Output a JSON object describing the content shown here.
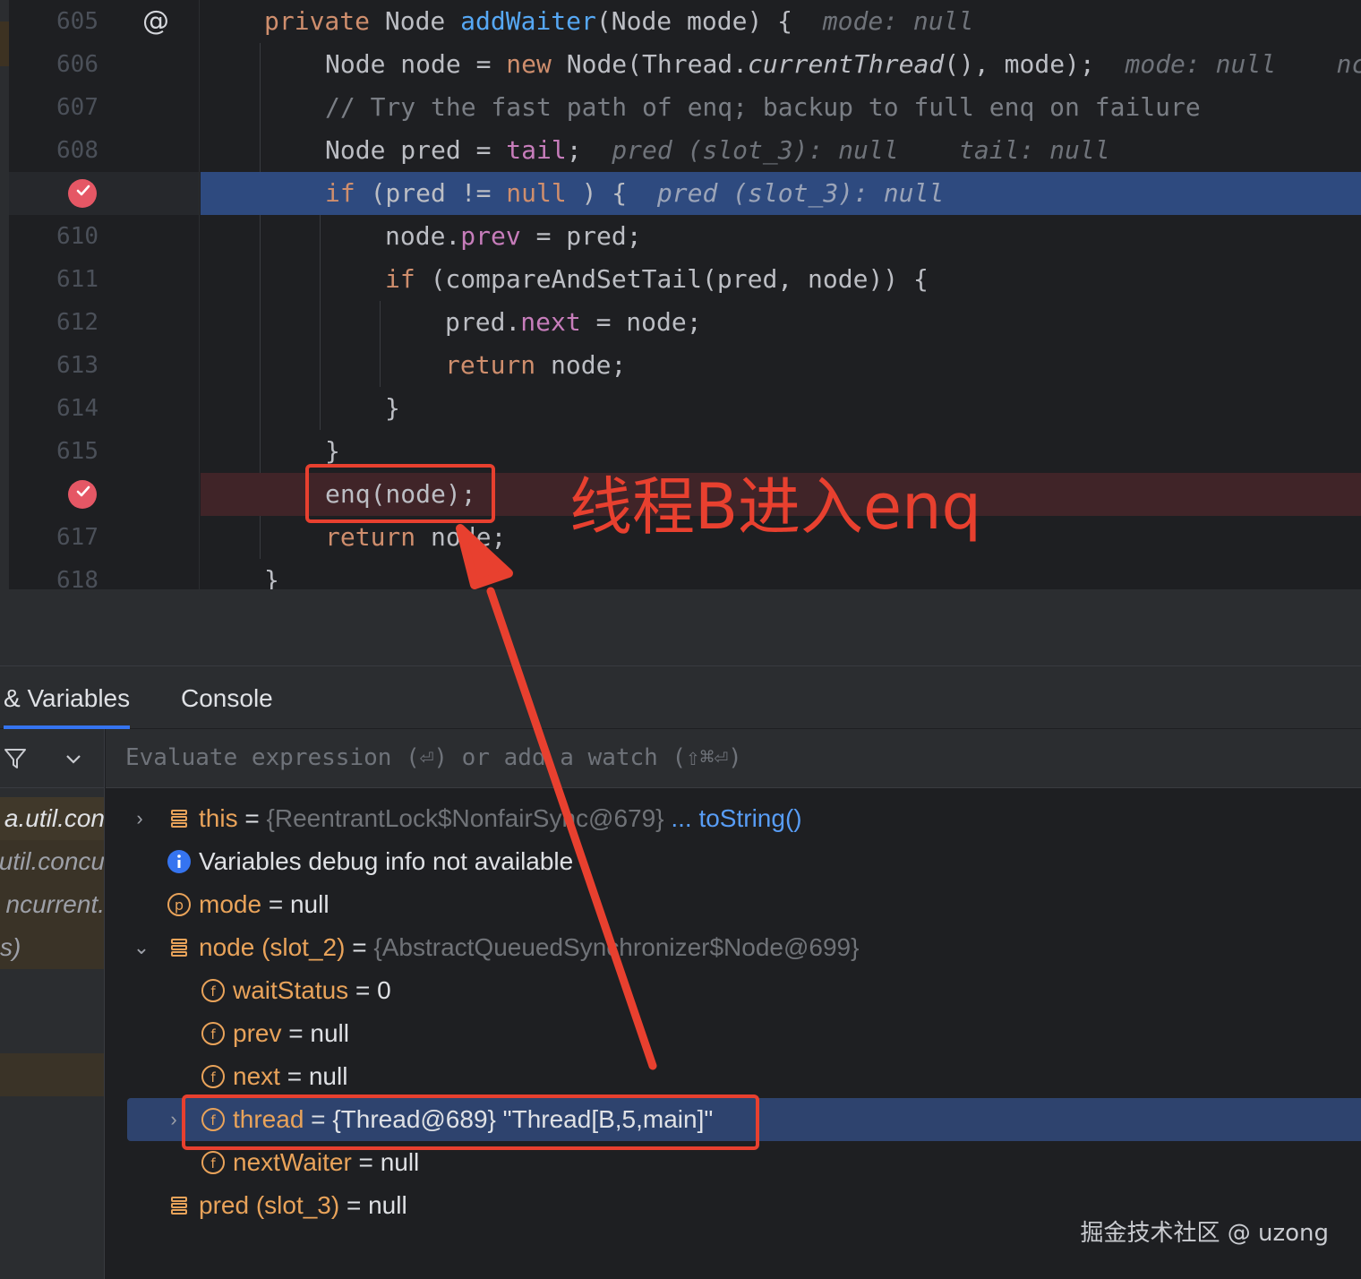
{
  "editor": {
    "lines": [
      {
        "no": "605",
        "parts": [
          [
            "kw",
            "private "
          ],
          [
            "",
            "Node "
          ],
          [
            "fn",
            "addWaiter"
          ],
          [
            "",
            "(Node mode) {  "
          ],
          [
            "hint",
            "mode: null"
          ]
        ]
      },
      {
        "no": "606",
        "parts": [
          [
            "",
            "Node node = "
          ],
          [
            "kw",
            "new "
          ],
          [
            "",
            "Node(Thread."
          ],
          [
            "it",
            "currentThread"
          ],
          [
            "",
            "(), mode);  "
          ],
          [
            "hint",
            "mode: null    nc"
          ]
        ]
      },
      {
        "no": "607",
        "parts": [
          [
            "cmt",
            "// Try the fast path of enq; backup to full enq on failure"
          ]
        ]
      },
      {
        "no": "608",
        "parts": [
          [
            "",
            "Node pred = "
          ],
          [
            "fld",
            "tail"
          ],
          [
            "",
            "; "
          ],
          [
            "hint",
            " pred (slot_3): null    tail: null"
          ]
        ]
      },
      {
        "no": "",
        "parts": [
          [
            "kw",
            "if "
          ],
          [
            "",
            "(pred != "
          ],
          [
            "kw",
            "null"
          ],
          [
            "",
            " ) {  "
          ],
          [
            "hint-hl",
            "pred (slot_3): null"
          ]
        ]
      },
      {
        "no": "610",
        "parts": [
          [
            "",
            "node."
          ],
          [
            "fld",
            "prev"
          ],
          [
            "",
            " = pred;"
          ]
        ]
      },
      {
        "no": "611",
        "parts": [
          [
            "kw",
            "if "
          ],
          [
            "",
            "(compareAndSetTail(pred, node)) {"
          ]
        ]
      },
      {
        "no": "612",
        "parts": [
          [
            "",
            "pred."
          ],
          [
            "fld",
            "next"
          ],
          [
            "",
            " = node;"
          ]
        ]
      },
      {
        "no": "613",
        "parts": [
          [
            "kw",
            "return "
          ],
          [
            "",
            "node;"
          ]
        ]
      },
      {
        "no": "614",
        "parts": [
          [
            "",
            "}"
          ]
        ]
      },
      {
        "no": "615",
        "parts": [
          [
            "",
            "}"
          ]
        ]
      },
      {
        "no": "",
        "parts": [
          [
            "",
            "enq(node);"
          ]
        ]
      },
      {
        "no": "617",
        "parts": [
          [
            "kw",
            "return "
          ],
          [
            "",
            "node;"
          ]
        ]
      },
      {
        "no": "618",
        "parts": [
          [
            "",
            "}"
          ]
        ]
      }
    ]
  },
  "annotation": "线程B进入enq",
  "tabs": {
    "variables": "& Variables",
    "console": "Console"
  },
  "evaluate": {
    "placeholder": "Evaluate expression (⏎) or add a watch (⇧⌘⏎)"
  },
  "frames": [
    "a.util.con",
    "util.concu",
    "ncurrent.",
    "s)"
  ],
  "variables": {
    "this_name": "this",
    "this_eq": " = ",
    "this_val": "{ReentrantLock$NonfairSync@679}",
    "this_link": " ... toString()",
    "info": "Variables debug info not available",
    "mode_name": "mode",
    "mode_val": " = null",
    "node_name": "node (slot_2)",
    "node_eq": " = ",
    "node_val": "{AbstractQueuedSynchronizer$Node@699}",
    "ws_name": "waitStatus",
    "ws_val": " = 0",
    "prev_name": "prev",
    "prev_val": " = null",
    "next_name": "next",
    "next_val": " = null",
    "thread_name": "thread",
    "thread_val": " = {Thread@689} \"Thread[B,5,main]\"",
    "nw_name": "nextWaiter",
    "nw_val": " = null",
    "pred_name": "pred (slot_3)",
    "pred_val": " = null"
  },
  "watermark": "掘金技术社区 @ uzong",
  "colors": {
    "annotation_red": "#e8402f",
    "current_line": "#2e4a7f",
    "breakpoint": "#e55765",
    "var_name": "#e9a35a"
  }
}
